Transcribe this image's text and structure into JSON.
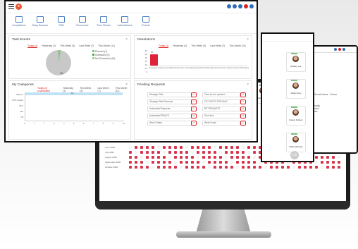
{
  "main": {
    "logo_text": "e",
    "nav": [
      {
        "label": "Completions"
      },
      {
        "label": "Diary Browser"
      },
      {
        "label": "PAR"
      },
      {
        "label": "Resources"
      },
      {
        "label": "Time Sheets"
      },
      {
        "label": "Lates/Absent"
      },
      {
        "label": "Events"
      }
    ],
    "task_events": {
      "title": "Task Events",
      "tabs": [
        "Today (4)",
        "Yesterday (1)",
        "This Week (3)",
        "Last Week (7)",
        "This Month (11)"
      ],
      "legend": [
        {
          "label": "Planned (1)",
          "color": "#7bc67b"
        },
        {
          "label": "Scheduled (0)",
          "color": "#5aa05a"
        },
        {
          "label": "Not Scheduled (40)",
          "color": "#a8d08d"
        }
      ],
      "pie_value": "40"
    },
    "my_categories": {
      "title": "My Categories",
      "tabs": [
        "Today (4) Unallocated",
        "Yesterday (1)",
        "This Week (3)",
        "Last Week (7)",
        "This Month (11)"
      ],
      "rows": [
        "Walk-In",
        "PPP Holder",
        "SFX",
        "Info",
        "FB"
      ],
      "x_ticks": [
        "0",
        "1",
        "2",
        "3",
        "4",
        "5",
        "6",
        "7",
        "8",
        "9",
        "10"
      ],
      "bar_value": "10"
    },
    "resolutions": {
      "title": "Resolutions",
      "tabs": [
        "Today (1)",
        "Yesterday (2)",
        "This Week (3)",
        "Last Week (7)",
        "This Month (11)"
      ],
      "y_ticks": [
        "60",
        "50",
        "40",
        "30",
        "20",
        "10",
        "0"
      ],
      "bar_value": "57",
      "x_labels": [
        "Unresolved",
        "Quality Issues/ Dispute",
        "Maintenance Issue",
        "Warranty",
        "Escalation",
        "Replaced",
        "Resolved",
        "Customer Failure",
        "Customer Dissatisfied"
      ]
    },
    "pending": {
      "title": "Pending Requests",
      "rows": [
        {
          "left": "Strategic Risk",
          "left_count": "1",
          "right": "Time for the update t...",
          "right_count": "2"
        },
        {
          "left": "Strategic Risk Removal",
          "left_count": "1",
          "right": "OC PHOTO FOR MAG",
          "right_count": "1"
        },
        {
          "left": "Automated Requests",
          "left_count": "7",
          "right": "RFT REQUEST",
          "right_count": "3"
        },
        {
          "left": "Automated PRAX'S",
          "left_count": "4",
          "right": "Tech test",
          "right_count": "2"
        },
        {
          "left": "Work Orders",
          "left_count": "4",
          "right": "Work Leave",
          "right_count": "1"
        }
      ]
    }
  },
  "mid_window": {
    "people": [
      {
        "name": "Bradley Lee",
        "tag": "Present"
      },
      {
        "name": "Adrian Fiery",
        "tag": "Present"
      },
      {
        "name": "Kasper Dobson",
        "tag": "Present"
      },
      {
        "name": "Pablo Richards",
        "tag": "Present"
      },
      {
        "name": "Luke Hart",
        "tag": "Present"
      }
    ],
    "badge": "LS"
  },
  "back_window": {
    "col1": "Additional Name",
    "col2": "Colour",
    "rows": [
      "Manually Inserted Values"
    ]
  },
  "monitor": {
    "people": [
      {
        "name": "Clifford Yen"
      },
      {
        "name": "Jonathan Ryan"
      },
      {
        "name": "Richard Williams"
      },
      {
        "name": "Harold Hare"
      },
      {
        "name": "Darius Sys"
      },
      {
        "name": "Hank Mathis"
      },
      {
        "name": "Alexander Owen"
      },
      {
        "name": "Samuel Adams"
      },
      {
        "name": "Terrell Smith"
      },
      {
        "name": "Darlay Stuck"
      },
      {
        "name": "Kevin Hart"
      }
    ],
    "months": [
      "June 2020",
      "July 2020",
      "August 2020",
      "September 2020",
      "October 2020"
    ]
  }
}
